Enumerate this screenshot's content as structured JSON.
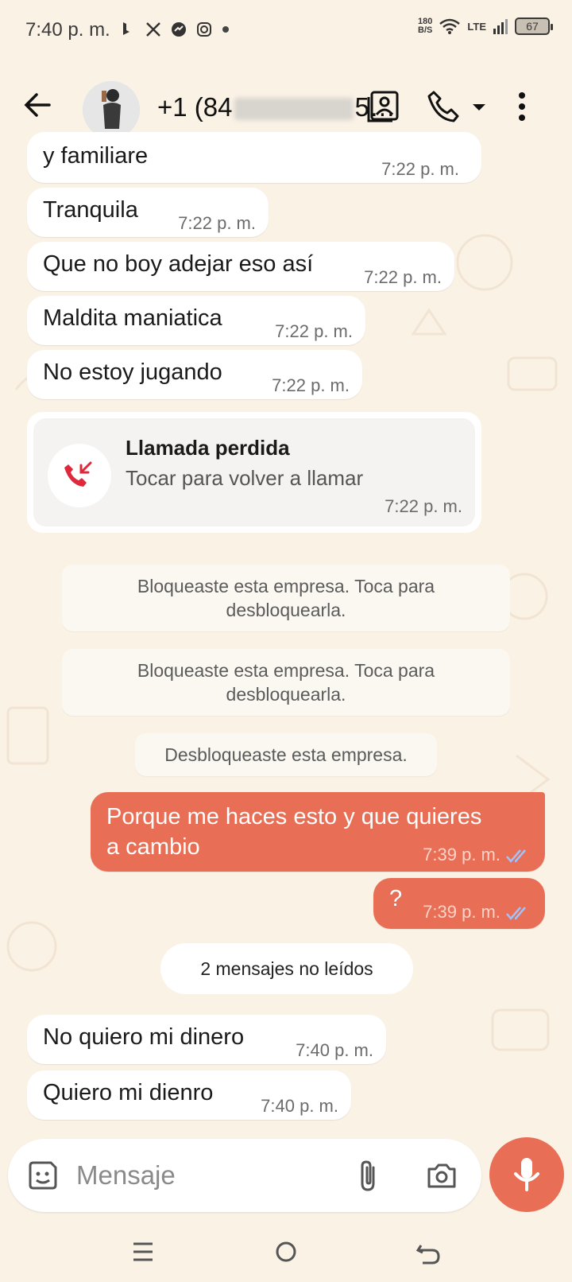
{
  "status_bar": {
    "time": "7:40 p. m.",
    "speed_value": "180",
    "speed_unit": "B/S",
    "network": "LTE",
    "battery": "67"
  },
  "header": {
    "contact_prefix": "+1 (84",
    "contact_suffix": "5…",
    "icons": [
      "back-arrow-icon",
      "contact-card-icon",
      "phone-icon",
      "dropdown-caret-icon",
      "more-vert-icon"
    ]
  },
  "messages": [
    {
      "text": "y familiare",
      "time": "7:22 p. m."
    },
    {
      "text": "Tranquila",
      "time": "7:22 p. m."
    },
    {
      "text": "Que no boy adejar eso así",
      "time": "7:22 p. m."
    },
    {
      "text": "Maldita maniatica",
      "time": "7:22 p. m."
    },
    {
      "text": "No estoy jugando",
      "time": "7:22 p. m."
    }
  ],
  "missed_call": {
    "title": "Llamada perdida",
    "subtitle": "Tocar para volver a llamar",
    "time": "7:22 p. m."
  },
  "system_notices": [
    {
      "line1": "Bloqueaste esta empresa. Toca para",
      "line2": "desbloquearla."
    },
    {
      "line1": "Bloqueaste esta empresa. Toca para",
      "line2": "desbloquearla."
    },
    {
      "line1": "Desbloqueaste esta empresa."
    }
  ],
  "outgoing": [
    {
      "line1": "Porque me haces esto y que quieres",
      "line2": "a cambio",
      "time": "7:39 p. m."
    },
    {
      "text": "?",
      "time": "7:39 p. m."
    }
  ],
  "unread_label": "2 mensajes no leídos",
  "incoming_new": [
    {
      "text": "No quiero mi dinero",
      "time": "7:40 p. m."
    },
    {
      "text": "Quiero mi dienro",
      "time": "7:40 p. m."
    }
  ],
  "composer": {
    "placeholder": "Mensaje"
  },
  "colors": {
    "background": "#fbf2e6",
    "outgoing_bubble": "#e86f56",
    "missed_call_red": "#e0283d",
    "read_ticks": "#9fc3ff"
  }
}
